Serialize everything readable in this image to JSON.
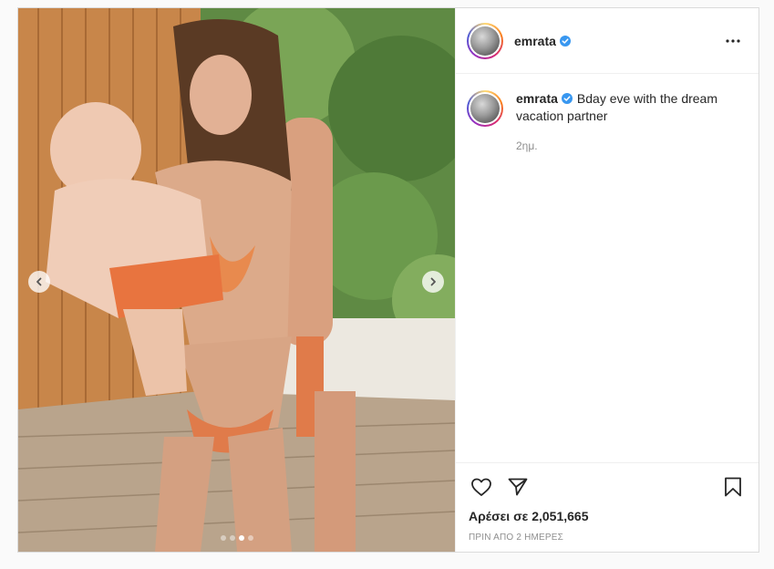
{
  "post": {
    "username": "emrata",
    "verified": true,
    "caption": "Bday eve with the dream vacation partner",
    "time_short": "2ημ.",
    "likes_text": "Αρέσει σε 2,051,665",
    "time_ago": "ΠΡΙΝ ΑΠΟ 2 ΗΜΕΡΕΣ"
  },
  "carousel": {
    "slide_count": 4,
    "active_index": 2
  },
  "icons": {
    "prev": "chevron-left-icon",
    "next": "chevron-right-icon",
    "more": "more-horizontal-icon",
    "like": "heart-icon",
    "share": "paper-plane-icon",
    "save": "bookmark-icon",
    "verified": "verified-badge-icon"
  },
  "colors": {
    "verified_blue": "#3897f0",
    "text": "#262626",
    "secondary_text": "#8e8e8e",
    "border": "#dbdbdb"
  }
}
